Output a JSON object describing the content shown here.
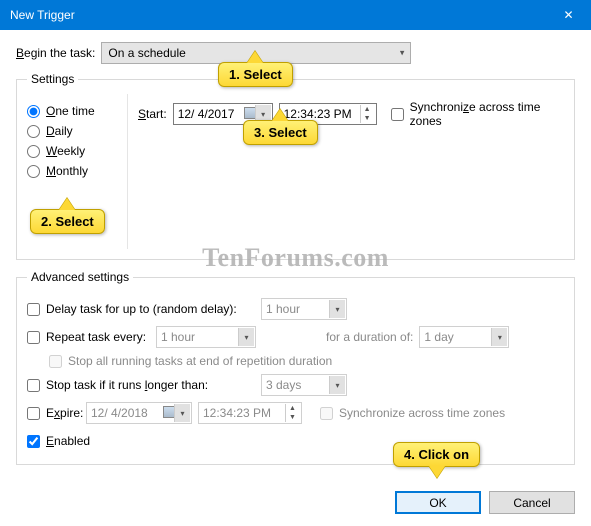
{
  "window": {
    "title": "New Trigger"
  },
  "begin": {
    "label": "Begin the task:",
    "value": "On a schedule"
  },
  "settings": {
    "legend": "Settings",
    "radios": [
      {
        "label": "One time",
        "checked": true,
        "u": "O"
      },
      {
        "label": "Daily",
        "u": "D"
      },
      {
        "label": "Weekly",
        "u": "W"
      },
      {
        "label": "Monthly",
        "u": "M"
      }
    ],
    "start_label": "Start:",
    "date": "12/ 4/2017",
    "time": "12:34:23 PM",
    "sync_label": "Synchronize across time zones"
  },
  "advanced": {
    "legend": "Advanced settings",
    "delay_label": "Delay task for up to (random delay):",
    "delay_value": "1 hour",
    "repeat_label": "Repeat task every:",
    "repeat_value": "1 hour",
    "duration_label": "for a duration of:",
    "duration_value": "1 day",
    "stop_all_label": "Stop all running tasks at end of repetition duration",
    "stop_longer_label": "Stop task if it runs longer than:",
    "stop_longer_value": "3 days",
    "expire_label": "Expire:",
    "expire_date": "12/ 4/2018",
    "expire_time": "12:34:23 PM",
    "expire_sync_label": "Synchronize across time zones",
    "enabled_label": "Enabled"
  },
  "buttons": {
    "ok": "OK",
    "cancel": "Cancel"
  },
  "annotations": {
    "a1": "1. Select",
    "a2": "2. Select",
    "a3": "3. Select",
    "a4": "4. Click on"
  },
  "watermark": "TenForums.com"
}
